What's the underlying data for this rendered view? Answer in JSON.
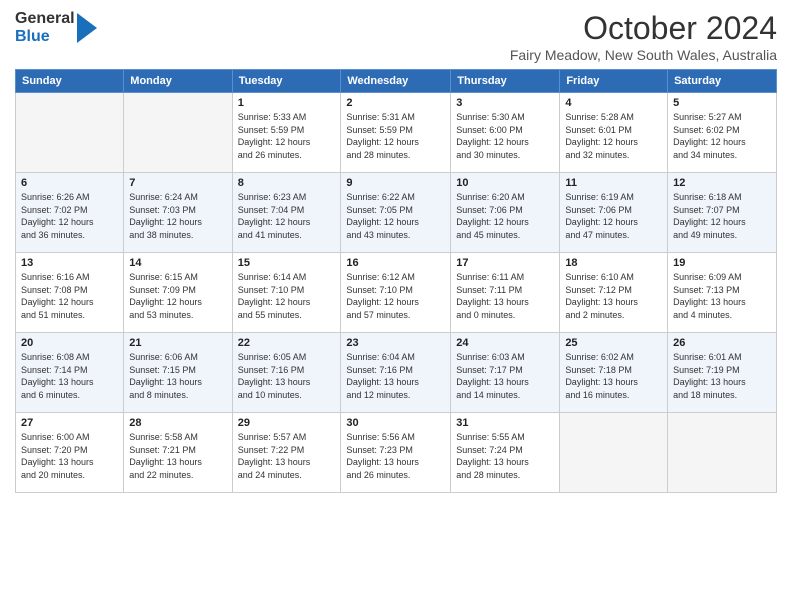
{
  "logo": {
    "general": "General",
    "blue": "Blue"
  },
  "header": {
    "title": "October 2024",
    "subtitle": "Fairy Meadow, New South Wales, Australia"
  },
  "days_of_week": [
    "Sunday",
    "Monday",
    "Tuesday",
    "Wednesday",
    "Thursday",
    "Friday",
    "Saturday"
  ],
  "weeks": [
    [
      {
        "day": "",
        "detail": ""
      },
      {
        "day": "",
        "detail": ""
      },
      {
        "day": "1",
        "detail": "Sunrise: 5:33 AM\nSunset: 5:59 PM\nDaylight: 12 hours\nand 26 minutes."
      },
      {
        "day": "2",
        "detail": "Sunrise: 5:31 AM\nSunset: 5:59 PM\nDaylight: 12 hours\nand 28 minutes."
      },
      {
        "day": "3",
        "detail": "Sunrise: 5:30 AM\nSunset: 6:00 PM\nDaylight: 12 hours\nand 30 minutes."
      },
      {
        "day": "4",
        "detail": "Sunrise: 5:28 AM\nSunset: 6:01 PM\nDaylight: 12 hours\nand 32 minutes."
      },
      {
        "day": "5",
        "detail": "Sunrise: 5:27 AM\nSunset: 6:02 PM\nDaylight: 12 hours\nand 34 minutes."
      }
    ],
    [
      {
        "day": "6",
        "detail": "Sunrise: 6:26 AM\nSunset: 7:02 PM\nDaylight: 12 hours\nand 36 minutes."
      },
      {
        "day": "7",
        "detail": "Sunrise: 6:24 AM\nSunset: 7:03 PM\nDaylight: 12 hours\nand 38 minutes."
      },
      {
        "day": "8",
        "detail": "Sunrise: 6:23 AM\nSunset: 7:04 PM\nDaylight: 12 hours\nand 41 minutes."
      },
      {
        "day": "9",
        "detail": "Sunrise: 6:22 AM\nSunset: 7:05 PM\nDaylight: 12 hours\nand 43 minutes."
      },
      {
        "day": "10",
        "detail": "Sunrise: 6:20 AM\nSunset: 7:06 PM\nDaylight: 12 hours\nand 45 minutes."
      },
      {
        "day": "11",
        "detail": "Sunrise: 6:19 AM\nSunset: 7:06 PM\nDaylight: 12 hours\nand 47 minutes."
      },
      {
        "day": "12",
        "detail": "Sunrise: 6:18 AM\nSunset: 7:07 PM\nDaylight: 12 hours\nand 49 minutes."
      }
    ],
    [
      {
        "day": "13",
        "detail": "Sunrise: 6:16 AM\nSunset: 7:08 PM\nDaylight: 12 hours\nand 51 minutes."
      },
      {
        "day": "14",
        "detail": "Sunrise: 6:15 AM\nSunset: 7:09 PM\nDaylight: 12 hours\nand 53 minutes."
      },
      {
        "day": "15",
        "detail": "Sunrise: 6:14 AM\nSunset: 7:10 PM\nDaylight: 12 hours\nand 55 minutes."
      },
      {
        "day": "16",
        "detail": "Sunrise: 6:12 AM\nSunset: 7:10 PM\nDaylight: 12 hours\nand 57 minutes."
      },
      {
        "day": "17",
        "detail": "Sunrise: 6:11 AM\nSunset: 7:11 PM\nDaylight: 13 hours\nand 0 minutes."
      },
      {
        "day": "18",
        "detail": "Sunrise: 6:10 AM\nSunset: 7:12 PM\nDaylight: 13 hours\nand 2 minutes."
      },
      {
        "day": "19",
        "detail": "Sunrise: 6:09 AM\nSunset: 7:13 PM\nDaylight: 13 hours\nand 4 minutes."
      }
    ],
    [
      {
        "day": "20",
        "detail": "Sunrise: 6:08 AM\nSunset: 7:14 PM\nDaylight: 13 hours\nand 6 minutes."
      },
      {
        "day": "21",
        "detail": "Sunrise: 6:06 AM\nSunset: 7:15 PM\nDaylight: 13 hours\nand 8 minutes."
      },
      {
        "day": "22",
        "detail": "Sunrise: 6:05 AM\nSunset: 7:16 PM\nDaylight: 13 hours\nand 10 minutes."
      },
      {
        "day": "23",
        "detail": "Sunrise: 6:04 AM\nSunset: 7:16 PM\nDaylight: 13 hours\nand 12 minutes."
      },
      {
        "day": "24",
        "detail": "Sunrise: 6:03 AM\nSunset: 7:17 PM\nDaylight: 13 hours\nand 14 minutes."
      },
      {
        "day": "25",
        "detail": "Sunrise: 6:02 AM\nSunset: 7:18 PM\nDaylight: 13 hours\nand 16 minutes."
      },
      {
        "day": "26",
        "detail": "Sunrise: 6:01 AM\nSunset: 7:19 PM\nDaylight: 13 hours\nand 18 minutes."
      }
    ],
    [
      {
        "day": "27",
        "detail": "Sunrise: 6:00 AM\nSunset: 7:20 PM\nDaylight: 13 hours\nand 20 minutes."
      },
      {
        "day": "28",
        "detail": "Sunrise: 5:58 AM\nSunset: 7:21 PM\nDaylight: 13 hours\nand 22 minutes."
      },
      {
        "day": "29",
        "detail": "Sunrise: 5:57 AM\nSunset: 7:22 PM\nDaylight: 13 hours\nand 24 minutes."
      },
      {
        "day": "30",
        "detail": "Sunrise: 5:56 AM\nSunset: 7:23 PM\nDaylight: 13 hours\nand 26 minutes."
      },
      {
        "day": "31",
        "detail": "Sunrise: 5:55 AM\nSunset: 7:24 PM\nDaylight: 13 hours\nand 28 minutes."
      },
      {
        "day": "",
        "detail": ""
      },
      {
        "day": "",
        "detail": ""
      }
    ]
  ]
}
